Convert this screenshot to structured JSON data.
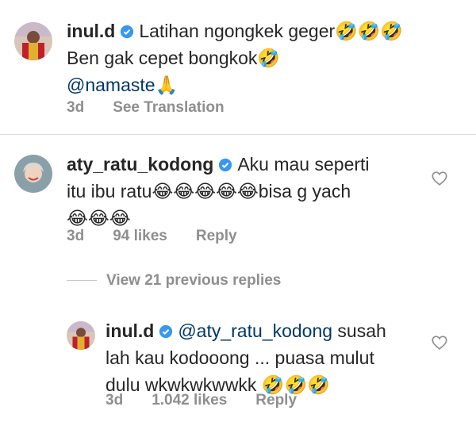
{
  "comments": [
    {
      "username": "inul.d",
      "text_line1": "Latihan ngongkek geger🤣🤣🤣",
      "text_line2": "Ben gak cepet bongkok🤣",
      "text_line3": "@namaste🙏",
      "time": "3d",
      "action": "See Translation"
    },
    {
      "username": "aty_ratu_kodong",
      "text_line1": "Aku mau seperti",
      "text_line2": "itu ibu ratu😂😂😂😂😂bisa g yach",
      "text_line3": "😂😂😂",
      "time": "3d",
      "likes": "94 likes",
      "action": "Reply"
    }
  ],
  "view_previous": "View 21 previous replies",
  "reply": {
    "username": "inul.d",
    "mention": "@aty_ratu_kodong",
    "text_line1_rest": " susah",
    "text_line2": "lah kau kodooong ... puasa mulut",
    "text_line3": "dulu wkwkwkwwkk 🤣🤣🤣",
    "time": "3d",
    "likes": "1.042 likes",
    "action": "Reply"
  },
  "colors": {
    "verified": "#3897f0",
    "mention": "#00376b",
    "meta": "#8e8e8e"
  },
  "icons": [
    "verified-badge-icon",
    "heart-icon"
  ]
}
